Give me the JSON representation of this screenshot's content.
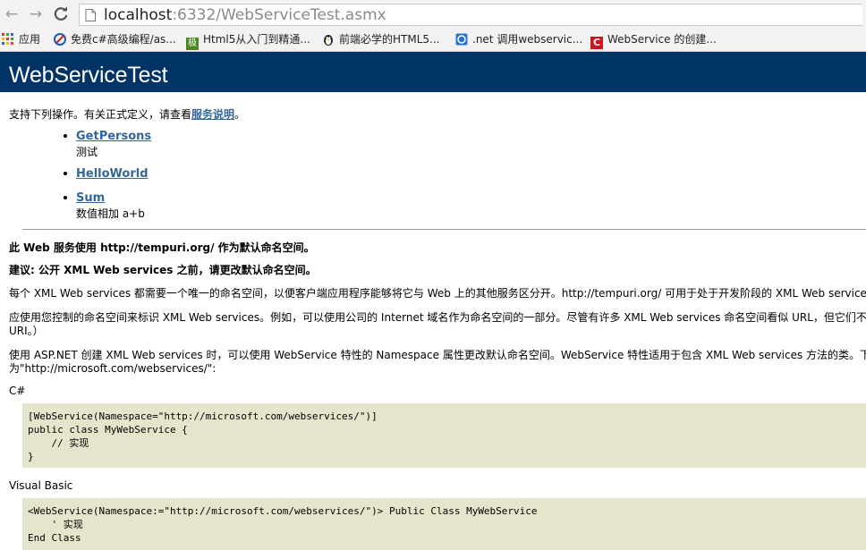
{
  "browser": {
    "url_host": "localhost",
    "url_rest": ":6332/WebServiceTest.asmx",
    "bookmarks": [
      {
        "label": "应用",
        "icon": "apps-grid-icon"
      },
      {
        "label": "免费c#高级编程/as...",
        "icon": "c-sharp-bookmark-icon"
      },
      {
        "label": "Html5从入门到精通...",
        "icon": "green-bookmark-icon"
      },
      {
        "label": "前端必学的HTML5...",
        "icon": "penguin-bookmark-icon"
      },
      {
        "label": ".net 调用webservic...",
        "icon": "blue-bookmark-icon"
      },
      {
        "label": "WebService 的创建...",
        "icon": "red-c-bookmark-icon"
      }
    ]
  },
  "page": {
    "title": "WebServiceTest",
    "intro_prefix": "支持下列操作。有关正式定义，请查看",
    "intro_link": "服务说明",
    "intro_suffix": "。",
    "operations": [
      {
        "name": "GetPersons",
        "description": "测试"
      },
      {
        "name": "HelloWorld",
        "description": ""
      },
      {
        "name": "Sum",
        "description": "数值相加 a+b"
      }
    ],
    "namespace_heading": "此 Web 服务使用 http://tempuri.org/ 作为默认命名空间。",
    "recommendation_heading": "建议: 公开 XML Web services 之前，请更改默认命名空间。",
    "para1": "每个 XML Web services 都需要一个唯一的命名空间，以便客户端应用程序能够将它与 Web 上的其他服务区分开。http://tempuri.org/ 可用于处于开发阶段的 XML Web services",
    "para2_line1": "应使用您控制的命名空间来标识 XML Web services。例如，可以使用公司的 Internet 域名作为命名空间的一部分。尽管有许多 XML Web services 命名空间看似 URL，但它们不",
    "para2_line2": "URI。）",
    "para3_line1": "使用 ASP.NET 创建 XML Web services 时，可以使用 WebService 特性的 Namespace 属性更改默认命名空间。WebService 特性适用于包含 XML Web services 方法的类。下",
    "para3_line2": "为\"http://microsoft.com/webservices/\":",
    "csharp_label": "C#",
    "csharp_code": "[WebService(Namespace=\"http://microsoft.com/webservices/\")]\npublic class MyWebService {\n    // 实现\n}",
    "vb_label": "Visual Basic",
    "vb_code": "<WebService(Namespace:=\"http://microsoft.com/webservices/\")> Public Class MyWebService\n    ' 实现\nEnd Class"
  }
}
